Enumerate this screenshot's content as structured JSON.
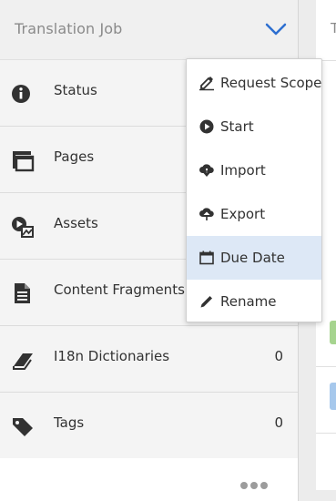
{
  "panel": {
    "title": "Translation Job",
    "rows": [
      {
        "label": "Status",
        "count": "",
        "icon": "info-icon"
      },
      {
        "label": "Pages",
        "count": "",
        "icon": "pages-icon"
      },
      {
        "label": "Assets",
        "count": "",
        "icon": "assets-icon"
      },
      {
        "label": "Content Fragments",
        "count": "",
        "icon": "document-icon"
      },
      {
        "label": "I18n Dictionaries",
        "count": "0",
        "icon": "dictionary-icon"
      },
      {
        "label": "Tags",
        "count": "0",
        "icon": "tag-icon"
      }
    ]
  },
  "right_panel": {
    "title_initial": "T"
  },
  "menu": {
    "items": [
      {
        "label": "Request Scope",
        "icon": "pen-scope-icon"
      },
      {
        "label": "Start",
        "icon": "play-icon"
      },
      {
        "label": "Import",
        "icon": "cloud-download-icon"
      },
      {
        "label": "Export",
        "icon": "cloud-upload-icon"
      },
      {
        "label": "Due Date",
        "icon": "calendar-icon"
      },
      {
        "label": "Rename",
        "icon": "pencil-icon"
      }
    ],
    "active_item": "Due Date"
  },
  "colors": {
    "chevron": "#2d6fd0",
    "active_menu_bg": "#dde8f6",
    "status_green": "#a6d48f",
    "status_blue": "#a6c8ec"
  }
}
